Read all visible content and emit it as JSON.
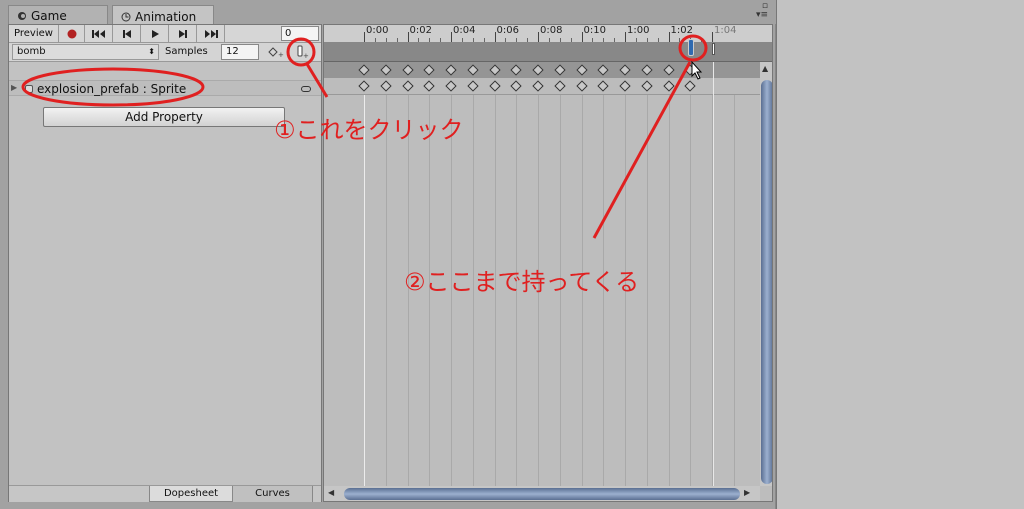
{
  "tabs": {
    "game": "Game",
    "animation": "Animation"
  },
  "toolbar": {
    "preview_label": "Preview",
    "frame_value": "0",
    "clip_name": "bomb",
    "samples_label": "Samples",
    "samples_value": "12"
  },
  "property": {
    "label": "explosion_prefab : Sprite"
  },
  "add_property_label": "Add Property",
  "bottom_tabs": {
    "dopesheet": "Dopesheet",
    "curves": "Curves"
  },
  "ruler": {
    "labels": [
      "0:00",
      "0:02",
      "0:04",
      "0:06",
      "0:08",
      "0:10",
      "1:00",
      "1:02",
      "1:04"
    ]
  },
  "annotations": {
    "step1": "①これをクリック",
    "step2": "②ここまで持ってくる"
  },
  "colors": {
    "annotation": "#e02020",
    "scrollbar": "#7b8fb0",
    "playhead": "#2f6ab0"
  }
}
